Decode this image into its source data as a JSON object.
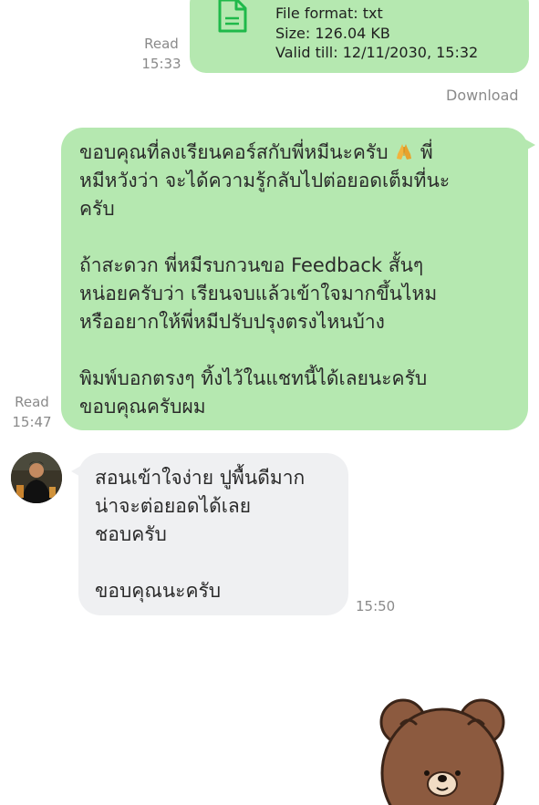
{
  "file_message": {
    "format_line": "File format: txt",
    "size_line": "Size: 126.04 KB",
    "valid_line": "Valid till: 12/11/2030, 15:32",
    "read_label": "Read",
    "time": "15:33",
    "download_label": "Download",
    "icon": "document-icon"
  },
  "outgoing_message": {
    "lines_p1": [
      "ขอบคุณที่ลงเรียนคอร์สกับพี่หมีนะครับ",
      "หมีหวังว่า จะได้ความรู้กลับไปต่อยอดเต็มที่นะ",
      "ครับ"
    ],
    "p1_tail": "พี่",
    "lines_p2": [
      "ถ้าสะดวก พี่หมีรบกวนขอ Feedback สั้นๆ",
      "หน่อยครับว่า เรียนจบแล้วเข้าใจมากขึ้นไหม",
      "หรืออยากให้พี่หมีปรับปรุงตรงไหนบ้าง"
    ],
    "lines_p3": [
      "พิมพ์บอกตรงๆ ทิ้งไว้ในแชทนี้ได้เลยนะครับ",
      "ขอบคุณครับผม"
    ],
    "emoji": "folded-hands-icon",
    "read_label": "Read",
    "time": "15:47"
  },
  "incoming_message": {
    "lines": [
      "สอนเข้าใจง่าย ปูพื้นดีมาก",
      "น่าจะต่อยอดได้เลย",
      "ชอบครับ"
    ],
    "last_line": "ขอบคุณนะครับ",
    "time": "15:50"
  },
  "sticker": {
    "icon": "brown-bear-sticker"
  },
  "colors": {
    "outgoing_bubble": "#b5e8b0",
    "incoming_bubble": "#eff0f2",
    "meta_text": "#8a8a8a",
    "file_icon": "#1fb94a"
  }
}
